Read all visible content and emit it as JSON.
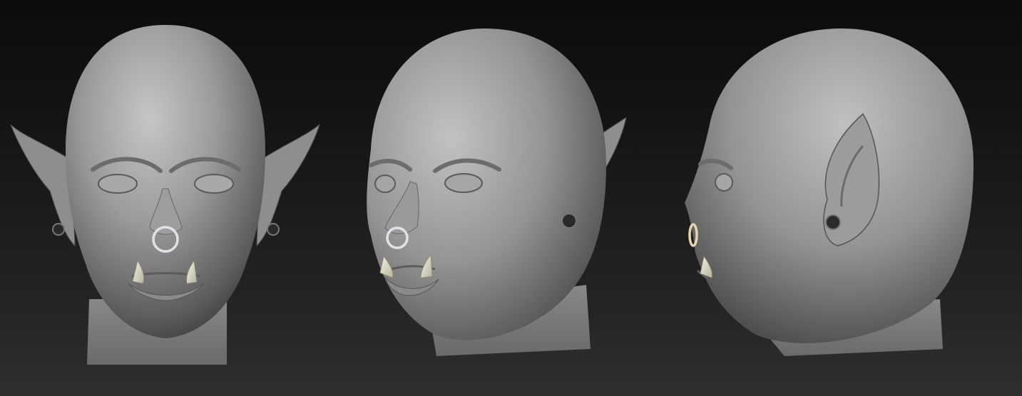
{
  "scene": {
    "subject": "orc head sculpt",
    "views": [
      {
        "id": "front",
        "name": "front-view"
      },
      {
        "id": "three-quarter",
        "name": "three-quarter-view"
      },
      {
        "id": "side",
        "name": "side-view"
      }
    ],
    "colors": {
      "background_top": "#0c0c0c",
      "background_bottom": "#2f2f2f",
      "skin_light": "#bdbdbd",
      "skin_mid": "#8c8c8c",
      "skin_dark": "#3a3a3a",
      "tusk": "#e6e3d2",
      "ring_metal": "#d8dde2"
    }
  }
}
